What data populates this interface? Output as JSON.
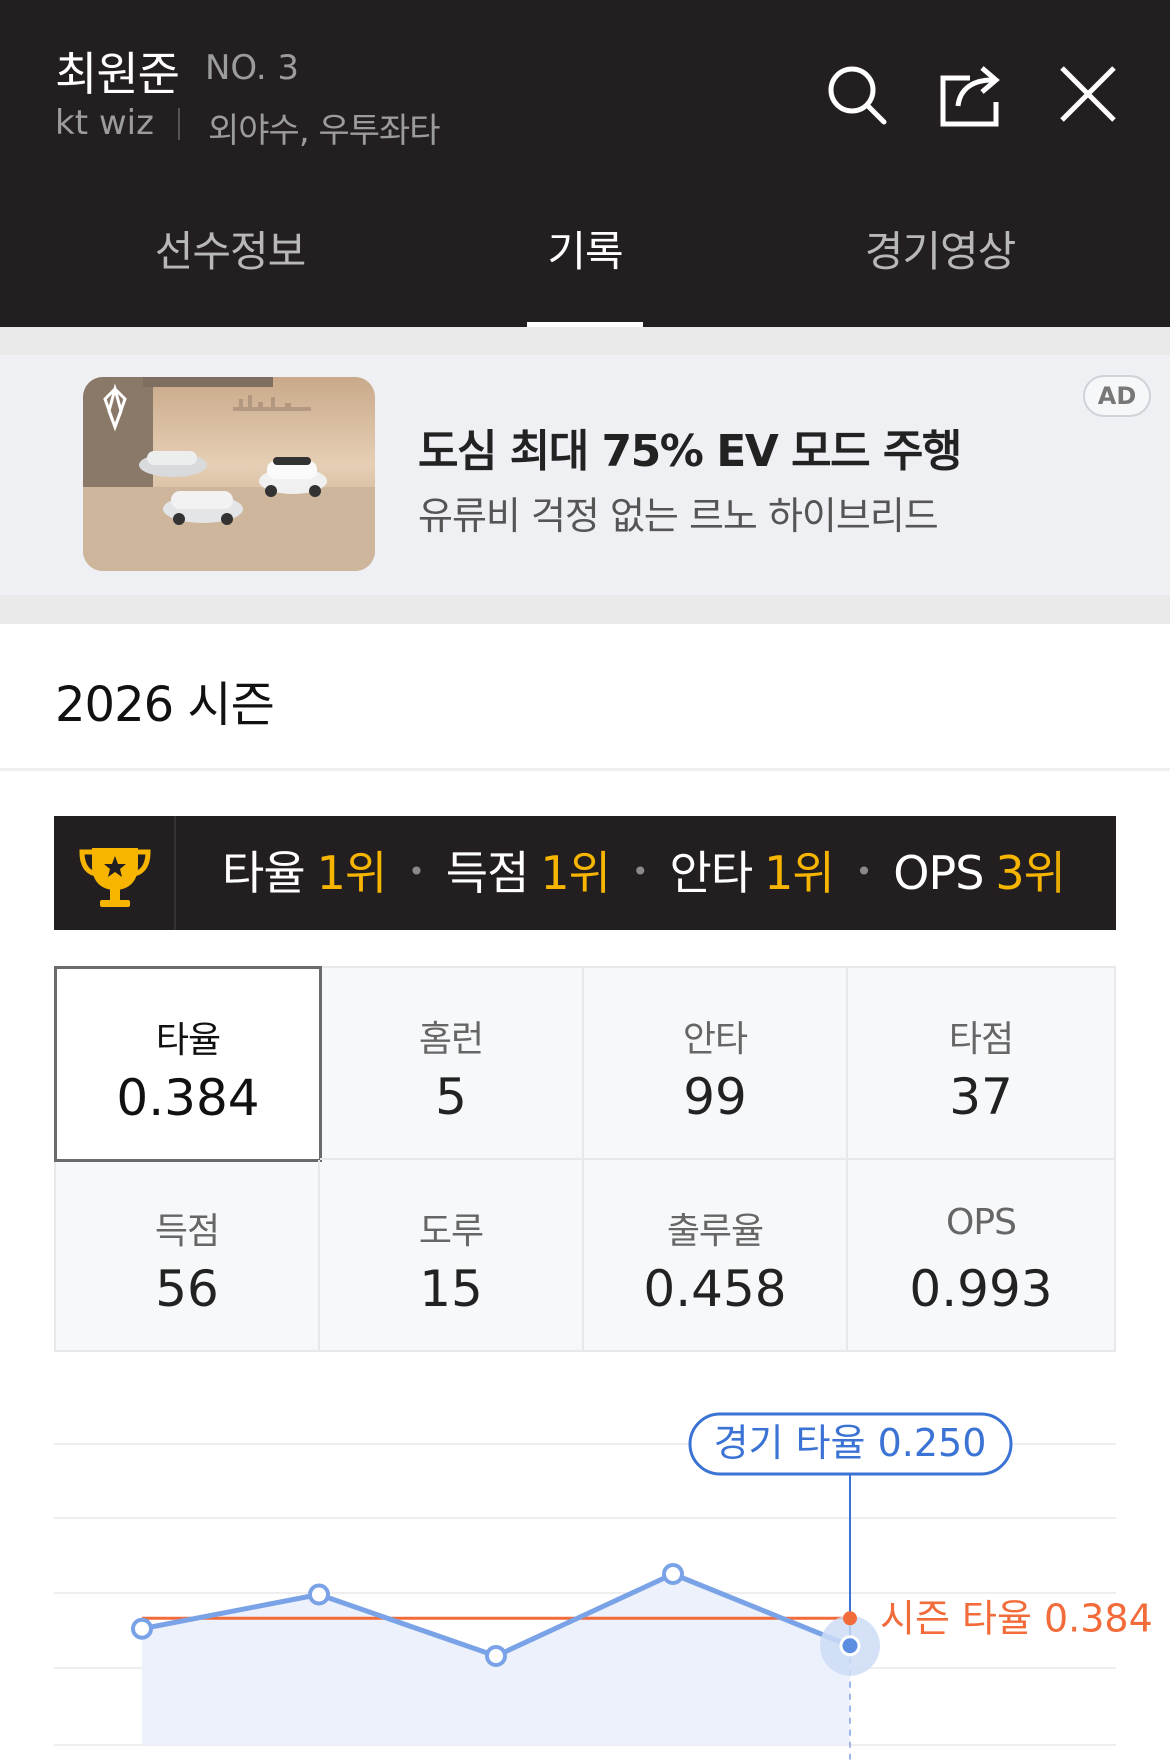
{
  "header": {
    "player_name": "최원준",
    "player_number": "NO. 3",
    "team": "kt wiz",
    "position": "외야수, 우투좌타",
    "icons": [
      "search-icon",
      "share-icon",
      "close-icon"
    ]
  },
  "tabs": [
    {
      "label": "선수정보",
      "active": false
    },
    {
      "label": "기록",
      "active": true
    },
    {
      "label": "경기영상",
      "active": false
    }
  ],
  "ad": {
    "headline": "도심 최대 75% EV 모드 주행",
    "subtext": "유류비 걱정 없는 르노 하이브리드",
    "badge": "AD"
  },
  "season": {
    "title": "2026 시즌"
  },
  "rankings": [
    {
      "label": "타율",
      "rank": "1위"
    },
    {
      "label": "득점",
      "rank": "1위"
    },
    {
      "label": "안타",
      "rank": "1위"
    },
    {
      "label": "OPS",
      "rank": "3위"
    }
  ],
  "stats": [
    {
      "label": "타율",
      "value": "0.384",
      "selected": true
    },
    {
      "label": "홈런",
      "value": "5",
      "selected": false
    },
    {
      "label": "안타",
      "value": "99",
      "selected": false
    },
    {
      "label": "타점",
      "value": "37",
      "selected": false
    },
    {
      "label": "득점",
      "value": "56",
      "selected": false
    },
    {
      "label": "도루",
      "value": "15",
      "selected": false
    },
    {
      "label": "출루율",
      "value": "0.458",
      "selected": false
    },
    {
      "label": "OPS",
      "value": "0.993",
      "selected": false
    }
  ],
  "colors": {
    "header_bg": "#231f20",
    "rank_accent": "#f7b500",
    "line_blue": "#7aa2e6",
    "tooltip_blue": "#3b73d4",
    "season_orange": "#f26b3a"
  },
  "chart": {
    "tooltip": "경기 타율 0.250",
    "season_label": "시즌 타율 0.384"
  },
  "chart_data": {
    "type": "line",
    "series": [
      {
        "values": [
          0.333,
          0.5,
          0.2,
          0.6,
          0.25
        ]
      }
    ],
    "reference_line": 0.384,
    "ylim": [
      0,
      1
    ],
    "grid": true,
    "highlighted_index": 4
  }
}
